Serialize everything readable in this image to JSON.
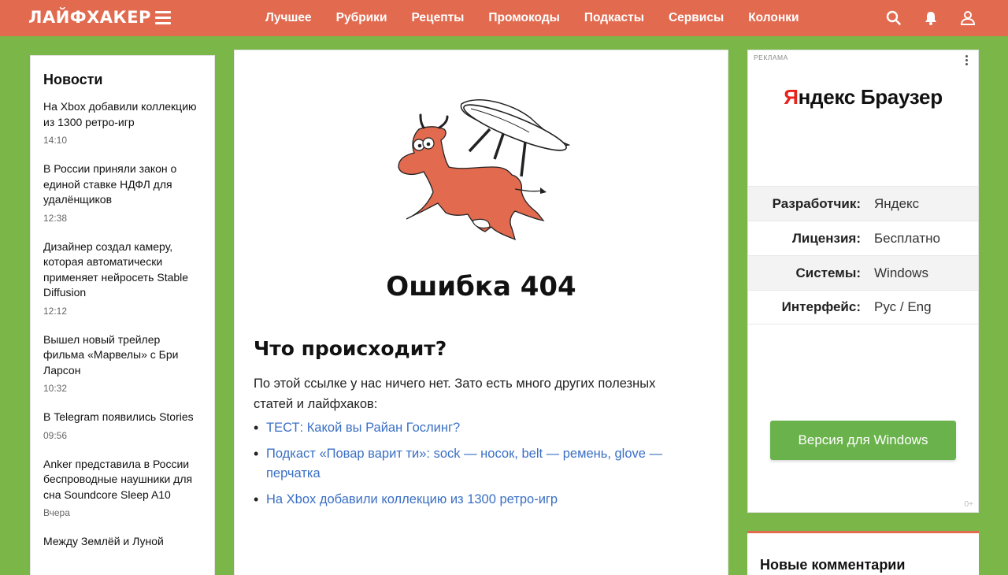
{
  "header": {
    "logo": "ЛАЙФХАКЕР",
    "nav": [
      "Лучшее",
      "Рубрики",
      "Рецепты",
      "Промокоды",
      "Подкасты",
      "Сервисы",
      "Колонки"
    ],
    "icons": [
      "search-icon",
      "bell-icon",
      "user-icon"
    ],
    "bg_color": "#e26a4f"
  },
  "news": {
    "title": "Новости",
    "items": [
      {
        "title": "На Xbox добавили коллекцию из 1300 ретро-игр",
        "time": "14:10"
      },
      {
        "title": "В России приняли закон о единой ставке НДФЛ для удалёнщиков",
        "time": "12:38"
      },
      {
        "title": "Дизайнер создал камеру, которая автоматически применяет нейросеть Stable Diffusion",
        "time": "12:12"
      },
      {
        "title": "Вышел новый трейлер фильма «Марвелы» с Бри Ларсон",
        "time": "10:32"
      },
      {
        "title": "В Telegram появились Stories",
        "time": "09:56"
      },
      {
        "title": "Anker представила в России беспроводные наушники для сна Soundcore Sleep A10",
        "time": "Вчера"
      },
      {
        "title": "Между Землёй и Луной",
        "time": ""
      }
    ]
  },
  "main": {
    "error_title": "Ошибка 404",
    "heading": "Что происходит?",
    "description": "По этой ссылке у нас ничего нет. Зато есть много других полезных статей и лайфхаков:",
    "links": [
      "ТЕСТ: Какой вы Райан Гослинг?",
      "Подкаст «Повар варит ти»: sock — носок, belt — ремень, glove — перчатка",
      "На Xbox добавили коллекцию из 1300 ретро-игр"
    ]
  },
  "ad": {
    "label": "РЕКЛАМА",
    "brand_first": "Я",
    "brand_rest": "ндекс Браузер",
    "rows": [
      {
        "key": "Разработчик:",
        "value": "Яндекс"
      },
      {
        "key": "Лицензия:",
        "value": "Бесплатно"
      },
      {
        "key": "Системы:",
        "value": "Windows"
      },
      {
        "key": "Интерфейс:",
        "value": "Рус / Eng"
      }
    ],
    "button": "Версия для Windows",
    "age": "0+"
  },
  "comments": {
    "title": "Новые комментарии"
  }
}
